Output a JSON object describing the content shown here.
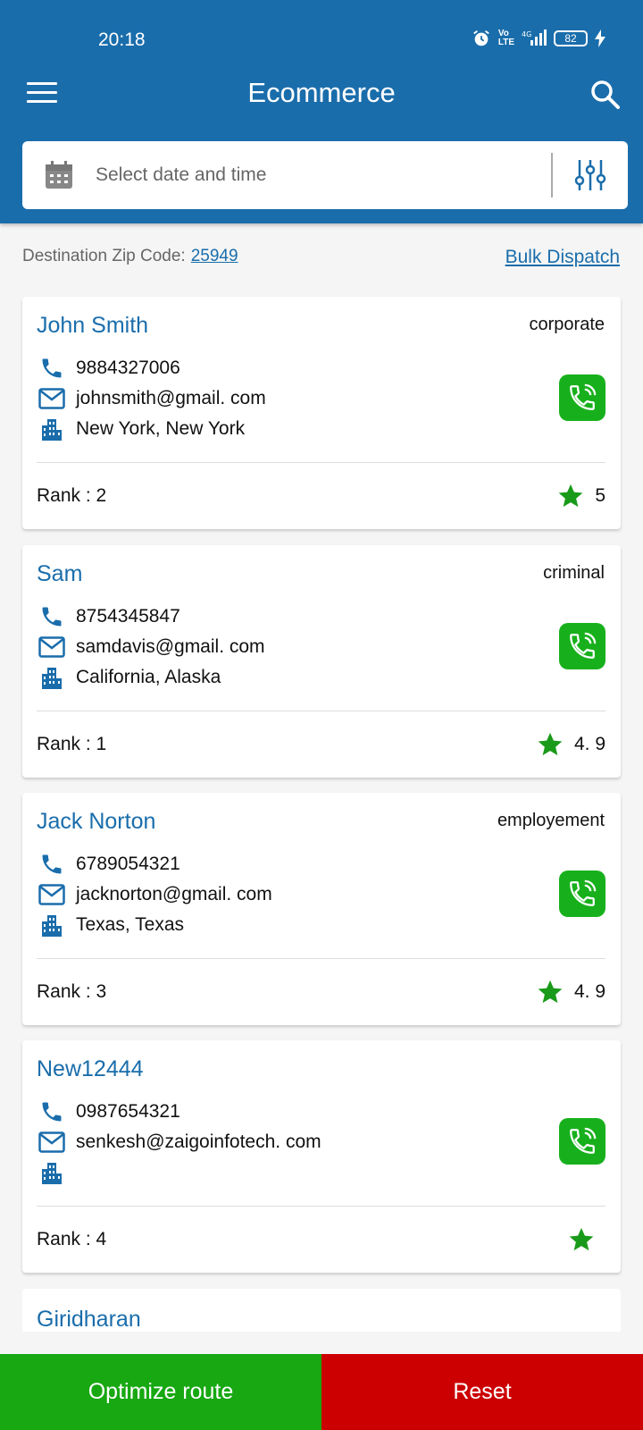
{
  "status_bar": {
    "time": "20:18",
    "battery": "82"
  },
  "header": {
    "title": "Ecommerce"
  },
  "date_picker": {
    "placeholder": "Select date and time"
  },
  "meta": {
    "zip_label": "Destination Zip Code:",
    "zip_value": "25949",
    "bulk_dispatch": "Bulk Dispatch"
  },
  "contacts": [
    {
      "name": "John Smith",
      "category": "corporate",
      "phone": "9884327006",
      "email": "johnsmith@gmail. com",
      "location": "New York,  New York",
      "rank_label": "Rank  :  2",
      "rating": "5"
    },
    {
      "name": "Sam",
      "category": "criminal",
      "phone": "8754345847",
      "email": "samdavis@gmail. com",
      "location": "California,  Alaska",
      "rank_label": "Rank  :  1",
      "rating": "4. 9"
    },
    {
      "name": "Jack Norton",
      "category": "employement",
      "phone": "6789054321",
      "email": "jacknorton@gmail. com",
      "location": "Texas,  Texas",
      "rank_label": "Rank  :  3",
      "rating": "4. 9"
    },
    {
      "name": "New12444",
      "category": "",
      "phone": "0987654321",
      "email": "senkesh@zaigoinfotech. com",
      "location": "",
      "rank_label": "Rank  :  4",
      "rating": ""
    },
    {
      "name": "Giridharan"
    }
  ],
  "footer": {
    "optimize": "Optimize route",
    "reset": "Reset"
  },
  "colors": {
    "primary": "#1a6dab",
    "call_green": "#17b01c",
    "optimize_green": "#17a812",
    "reset_red": "#cc0000",
    "star_green": "#1a9a1a"
  },
  "icons": [
    "menu-icon",
    "search-icon",
    "calendar-icon",
    "filter-sliders-icon",
    "phone-icon",
    "mail-icon",
    "building-icon",
    "phone-call-icon",
    "star-icon",
    "alarm-icon",
    "signal-icon"
  ]
}
